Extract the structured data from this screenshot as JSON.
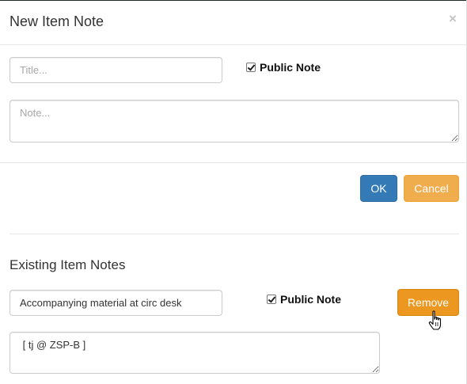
{
  "modal": {
    "title": "New Item Note",
    "close_label": "×"
  },
  "new_note": {
    "title_placeholder": "Title...",
    "note_placeholder": "Note...",
    "public_note_label": "Public Note",
    "public_note_checked": true,
    "ok_label": "OK",
    "cancel_label": "Cancel"
  },
  "existing": {
    "section_title": "Existing Item Notes",
    "notes": [
      {
        "title": "Accompanying material at circ desk",
        "note": " [ tj @ ZSP-B ]",
        "public_note_label": "Public Note",
        "public_note_checked": true,
        "remove_label": "Remove"
      }
    ]
  },
  "colors": {
    "primary": "#337ab7",
    "warning": "#f0ad4e",
    "warning_active": "#ec971f"
  },
  "icons": {
    "close": "close-icon",
    "cursor": "hand-pointer-cursor-icon",
    "checkbox": "checkmark-icon"
  }
}
